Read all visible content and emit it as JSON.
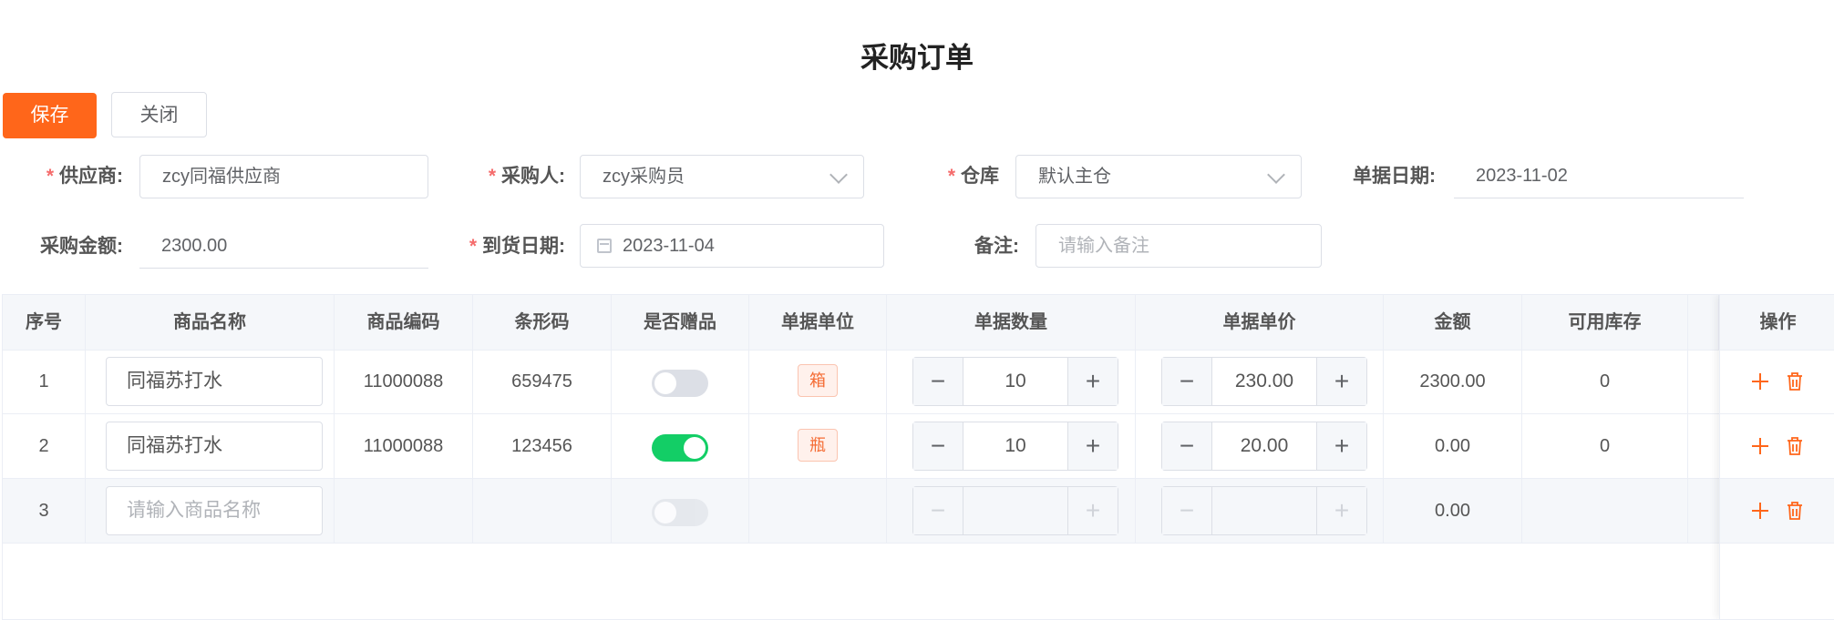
{
  "page": {
    "title": "采购订单"
  },
  "toolbar": {
    "save_label": "保存",
    "close_label": "关闭"
  },
  "form": {
    "supplier": {
      "label": "供应商:",
      "value": "zcy同福供应商"
    },
    "buyer": {
      "label": "采购人:",
      "value": "zcy采购员"
    },
    "warehouse": {
      "label": "仓库",
      "value": "默认主仓"
    },
    "doc_date": {
      "label": "单据日期:",
      "value": "2023-11-02"
    },
    "amount": {
      "label": "采购金额:",
      "value": "2300.00"
    },
    "arrival_date": {
      "label": "到货日期:",
      "value": "2023-11-04"
    },
    "remark": {
      "label": "备注:",
      "placeholder": "请输入备注"
    },
    "required_mark": "*"
  },
  "table": {
    "headers": [
      "序号",
      "商品名称",
      "商品编码",
      "条形码",
      "是否赠品",
      "单据单位",
      "单据数量",
      "单据单价",
      "金额",
      "可用库存",
      "",
      "操作"
    ],
    "rows": [
      {
        "seq": "1",
        "name": "同福苏打水",
        "code": "11000088",
        "barcode": "659475",
        "gift": false,
        "unit": "箱",
        "qty": "10",
        "price": "230.00",
        "amount": "2300.00",
        "stock": "0"
      },
      {
        "seq": "2",
        "name": "同福苏打水",
        "code": "11000088",
        "barcode": "123456",
        "gift": true,
        "unit": "瓶",
        "qty": "10",
        "price": "20.00",
        "amount": "0.00",
        "stock": "0"
      },
      {
        "seq": "3",
        "name": "",
        "name_placeholder": "请输入商品名称",
        "code": "",
        "barcode": "",
        "gift": false,
        "unit": "",
        "qty": "",
        "price": "",
        "amount": "0.00",
        "stock": ""
      }
    ],
    "minus_symbol": "−",
    "plus_symbol": "+"
  },
  "colors": {
    "accent": "#ff661a",
    "toggle_on": "#13ce66",
    "required": "#f56c6c"
  },
  "icons": {
    "add": "plus-icon",
    "delete": "trash-icon",
    "calendar": "calendar-icon",
    "dropdown": "chevron-down-icon"
  }
}
